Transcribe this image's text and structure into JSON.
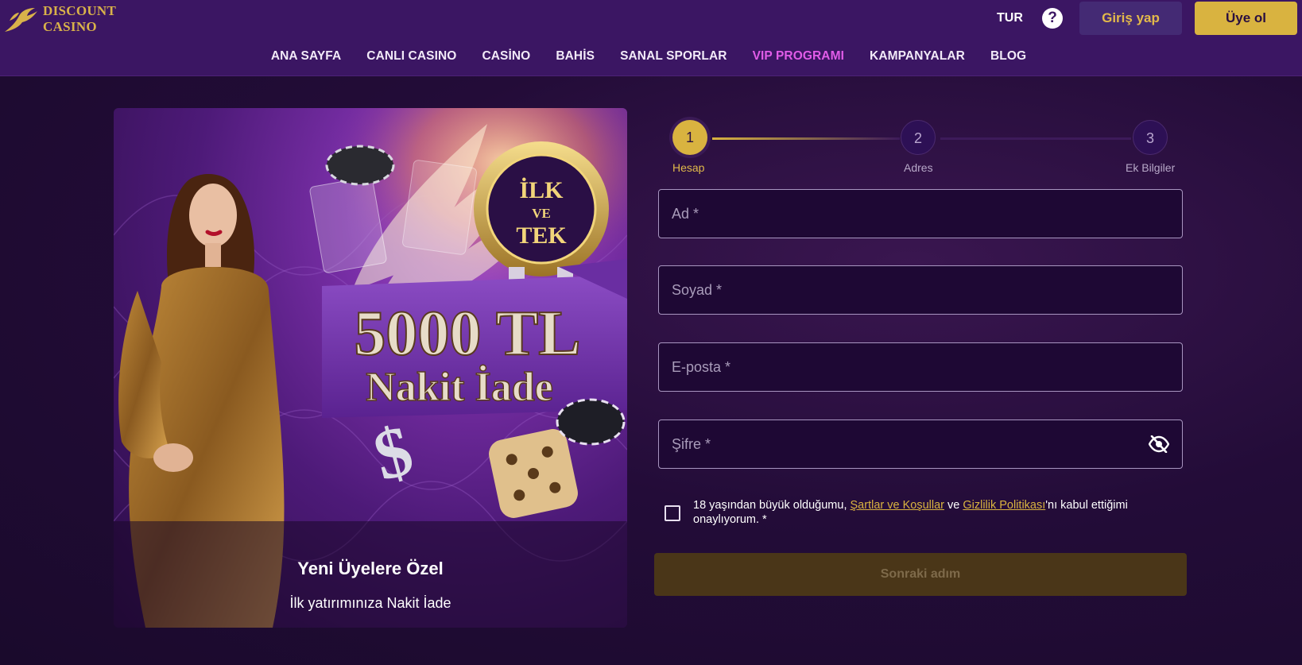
{
  "header": {
    "logo_line1": "DISCOUNT",
    "logo_line2": "CASINO",
    "language": "TUR",
    "help_label": "?",
    "login_label": "Giriş yap",
    "register_label": "Üye ol"
  },
  "nav": {
    "items": [
      {
        "label": "ANA SAYFA"
      },
      {
        "label": "CANLI CASINO"
      },
      {
        "label": "CASİNO"
      },
      {
        "label": "BAHİS"
      },
      {
        "label": "SANAL SPORLAR"
      },
      {
        "label": "VIP PROGRAMI",
        "active": true
      },
      {
        "label": "KAMPANYALAR"
      },
      {
        "label": "BLOG"
      }
    ]
  },
  "promo": {
    "badge_line1": "İLK",
    "badge_line2": "VE",
    "badge_line3": "TEK",
    "amount": "5000 TL",
    "offer": "Nakit İade",
    "title": "Yeni Üyelere Özel",
    "subtitle": "İlk yatırımınıza Nakit İade"
  },
  "stepper": {
    "steps": [
      {
        "number": "1",
        "label": "Hesap",
        "state": "active"
      },
      {
        "number": "2",
        "label": "Adres",
        "state": "pending"
      },
      {
        "number": "3",
        "label": "Ek Bilgiler",
        "state": "pending"
      }
    ]
  },
  "form": {
    "first_name_placeholder": "Ad *",
    "last_name_placeholder": "Soyad *",
    "email_placeholder": "E-posta *",
    "password_placeholder": "Şifre *",
    "terms_prefix": "18 yaşından büyük olduğumu, ",
    "terms_link": "Şartlar ve Koşullar",
    "terms_middle": " ve ",
    "privacy_link": "Gizlilik Politikası",
    "terms_suffix": "'nı kabul ettiğimi onaylıyorum. *",
    "next_label": "Sonraki adım"
  },
  "colors": {
    "accent_gold": "#d9b340",
    "nav_active": "#e15ce8",
    "header_bg": "#3b1663"
  }
}
